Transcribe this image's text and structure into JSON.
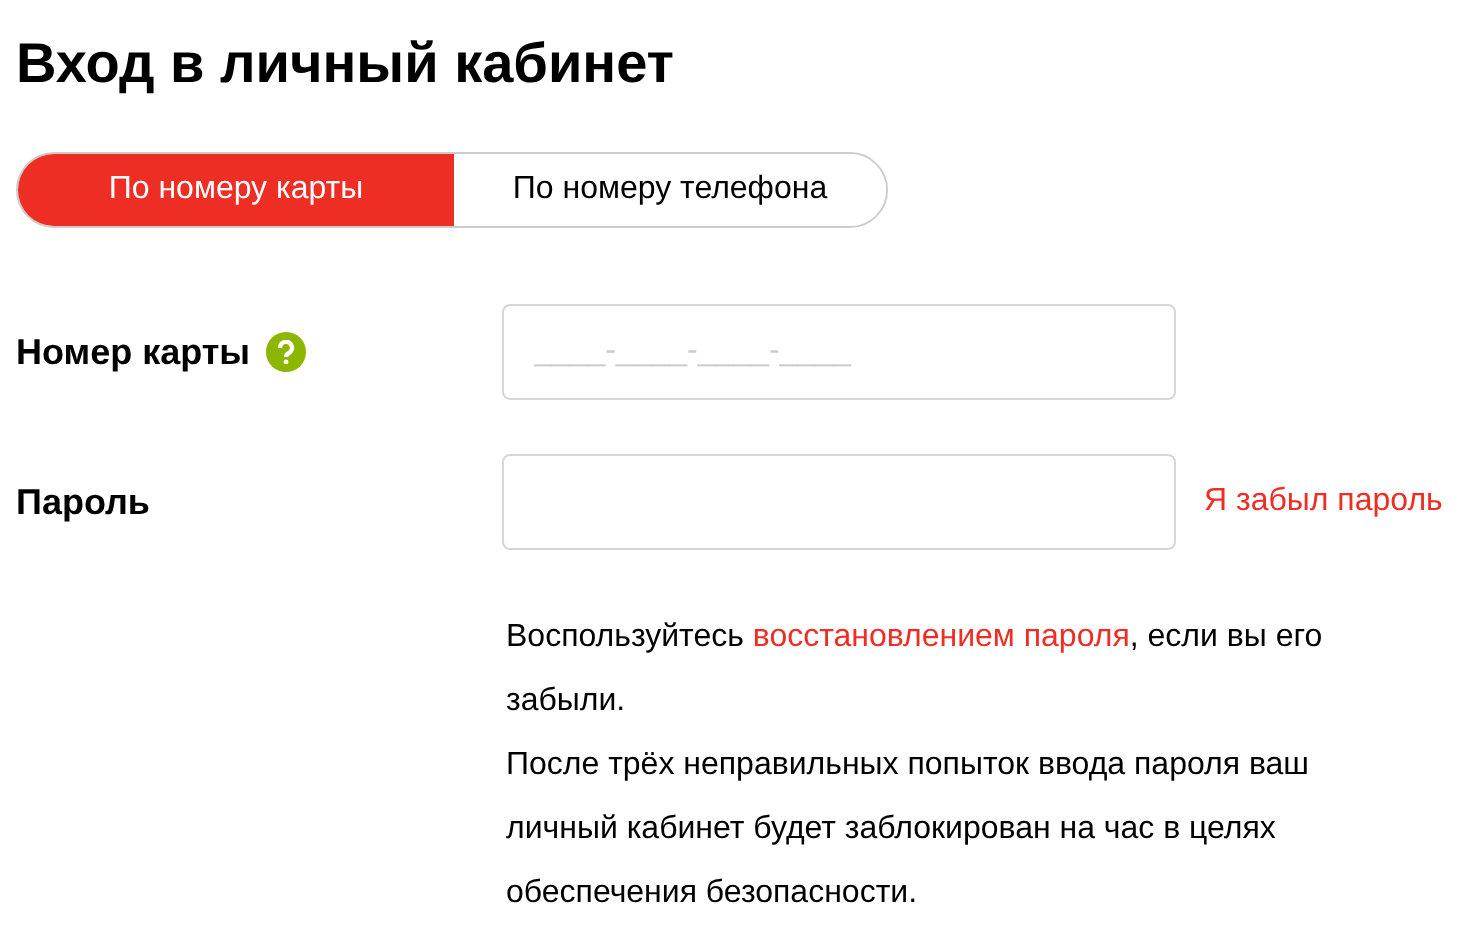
{
  "title": "Вход в личный кабинет",
  "tabs": [
    {
      "label": "По номеру карты",
      "selected": true
    },
    {
      "label": "По номеру телефона",
      "selected": false
    }
  ],
  "fields": [
    {
      "label": "Номер карты",
      "help_icon": true,
      "placeholder": "____-____-____-____"
    },
    {
      "label": "Пароль",
      "link": "Я забыл пароль"
    }
  ],
  "notice": {
    "before": "Воспользуйтесь ",
    "link": "восстановлением пароля",
    "after": ", если вы его забыли.",
    "warning": "После трёх неправильных попыток ввода пароля ваш личный кабинет будет заблокирован на час в целях обеспечения безопасности."
  }
}
